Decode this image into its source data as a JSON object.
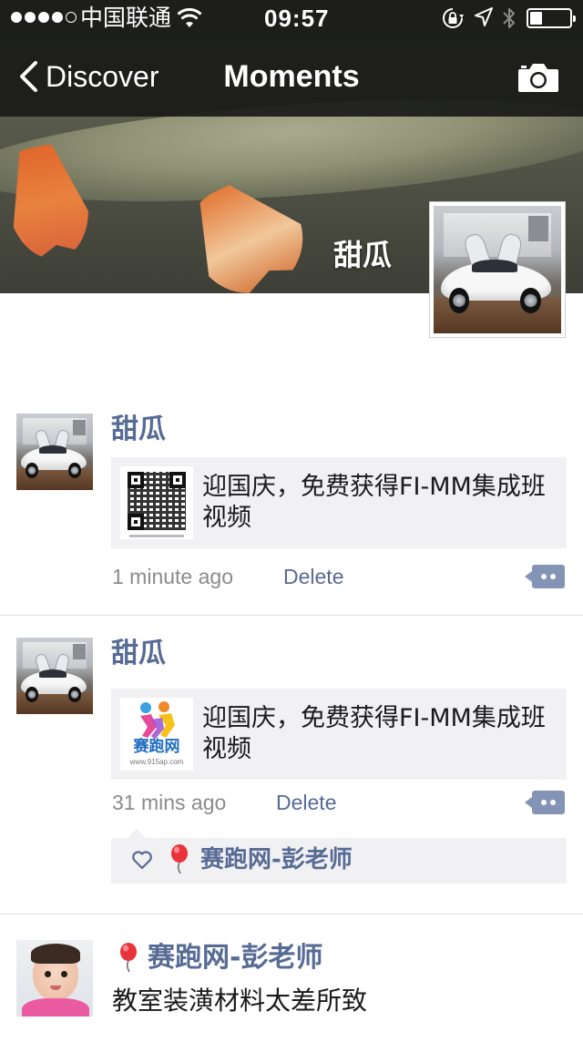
{
  "status_bar": {
    "carrier": "中国联通",
    "time": "09:57",
    "signal_bars_filled": 4,
    "signal_bars_total": 5,
    "battery_level": 0.3
  },
  "nav": {
    "back_label": "Discover",
    "title": "Moments",
    "camera_icon": "camera-icon"
  },
  "profile": {
    "name": "甜瓜"
  },
  "posts": [
    {
      "user": "甜瓜",
      "link_title": "迎国庆，免费获得FI-MM集成班视频",
      "thumb_icon": "qr-code",
      "time": "1 minute ago",
      "delete_label": "Delete"
    },
    {
      "user": "甜瓜",
      "link_title": "迎国庆，免费获得FI-MM集成班视频",
      "thumb_icon": "saipao-logo",
      "thumb_logo_text": "赛跑网",
      "thumb_logo_url": "www.915ap.com",
      "time": "31 mins ago",
      "delete_label": "Delete",
      "likes": [
        "赛跑网-彭老师"
      ]
    },
    {
      "user": "赛跑网-彭老师",
      "text": "教室装潢材料太差所致"
    }
  ],
  "colors": {
    "link_blue": "#576b95",
    "card_bg": "#f1f1f3",
    "nav_bg": "#1a1b18"
  }
}
